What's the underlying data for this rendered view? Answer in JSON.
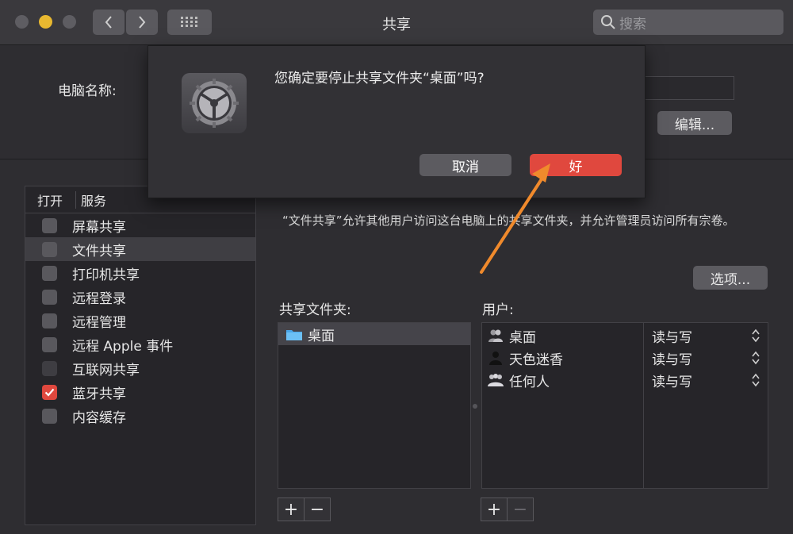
{
  "window": {
    "title": "共享",
    "search_placeholder": "搜索"
  },
  "computer": {
    "name_label": "电脑名称:",
    "edit_button": "编辑..."
  },
  "dialog": {
    "message": "您确定要停止共享文件夹“桌面”吗?",
    "cancel_label": "取消",
    "ok_label": "好",
    "ok_color": "#e0483e"
  },
  "services": {
    "header_on": "打开",
    "header_service": "服务",
    "items": [
      {
        "label": "屏幕共享",
        "checked": false
      },
      {
        "label": "文件共享",
        "checked": false,
        "selected": true
      },
      {
        "label": "打印机共享",
        "checked": false
      },
      {
        "label": "远程登录",
        "checked": false
      },
      {
        "label": "远程管理",
        "checked": false
      },
      {
        "label": "远程 Apple 事件",
        "checked": false
      },
      {
        "label": "互联网共享",
        "checked": false,
        "disabled": true
      },
      {
        "label": "蓝牙共享",
        "checked": true
      },
      {
        "label": "内容缓存",
        "checked": false
      }
    ]
  },
  "file_sharing": {
    "description": "“文件共享”允许其他用户访问这台电脑上的共享文件夹，并允许管理员访问所有宗卷。",
    "options_button": "选项...",
    "folders_label": "共享文件夹:",
    "users_label": "用户:",
    "folders": [
      "桌面"
    ],
    "users": [
      {
        "name": "桌面",
        "permission": "读与写",
        "icon": "group-icon"
      },
      {
        "name": "天色迷香",
        "permission": "读与写",
        "icon": "user-icon"
      },
      {
        "name": "任何人",
        "permission": "读与写",
        "icon": "everyone-icon"
      }
    ],
    "add_symbol": "+",
    "remove_symbol": "−"
  },
  "annotation": {
    "arrow_color": "#f08a2c"
  }
}
